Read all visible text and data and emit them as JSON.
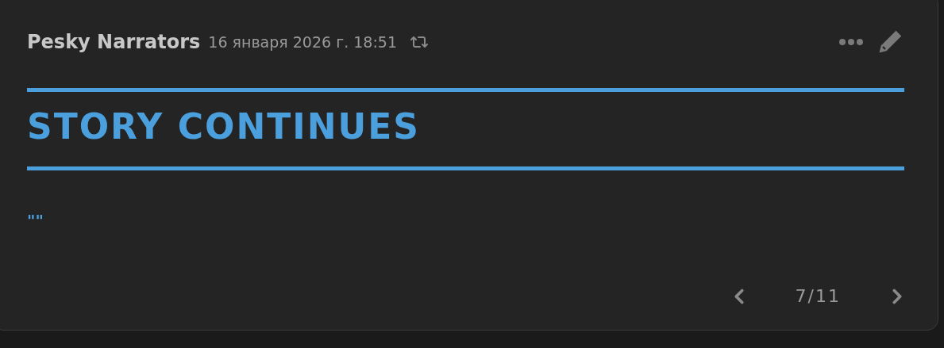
{
  "message": {
    "author": "Pesky Narrators",
    "timestamp": "16 января 2026 г. 18:51",
    "heading": "STORY CONTINUES",
    "body": "\"\""
  },
  "pager": {
    "counter": "7/11"
  }
}
